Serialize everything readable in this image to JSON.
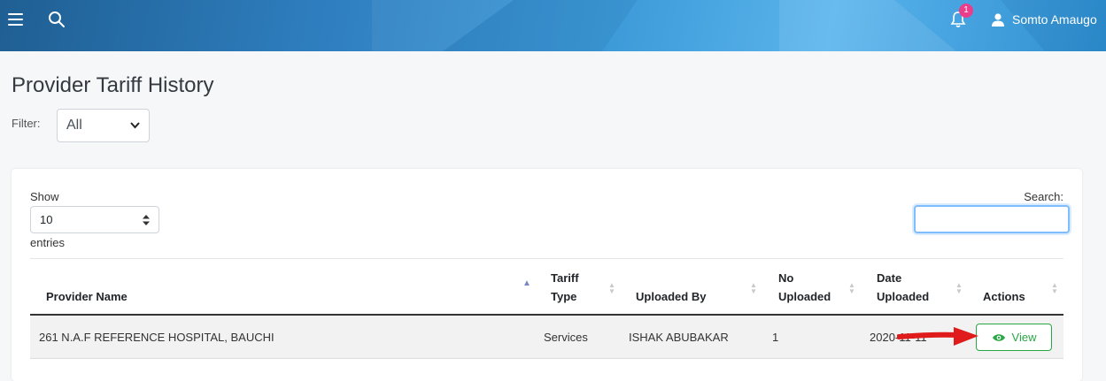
{
  "header": {
    "menu_icon": "hamburger-icon",
    "search_icon": "search-icon",
    "notification_icon": "bell-icon",
    "notification_count": "1",
    "user_icon": "user-icon",
    "user_name": "Somto Amaugo"
  },
  "page": {
    "title": "Provider Tariff History",
    "filter_label": "Filter:",
    "filter_value": "All"
  },
  "table_controls": {
    "show_label": "Show",
    "entries_value": "10",
    "entries_label": "entries",
    "search_label": "Search:",
    "search_value": ""
  },
  "table": {
    "columns": [
      "Provider Name",
      "Tariff Type",
      "Uploaded By",
      "No Uploaded",
      "Date Uploaded",
      "Actions"
    ],
    "column_lines": [
      [
        "Provider Name"
      ],
      [
        "Tariff",
        "Type"
      ],
      [
        "Uploaded By"
      ],
      [
        "No",
        "Uploaded"
      ],
      [
        "Date",
        "Uploaded"
      ],
      [
        "Actions"
      ]
    ],
    "sorted_column": "Provider Name",
    "rows": [
      {
        "provider_name": "261 N.A.F REFERENCE HOSPITAL, BAUCHI",
        "tariff_type": "Services",
        "uploaded_by": "ISHAK ABUBAKAR",
        "no_uploaded": "1",
        "date_uploaded": "2020-11-11",
        "action_label": "View",
        "action_icon": "eye-icon"
      }
    ]
  },
  "annotation": {
    "arrow_color": "#e01b1b",
    "arrow_icon": "arrow-right-icon"
  },
  "colors": {
    "accent": "#28a745",
    "header": "#3d9ad8",
    "badge": "#e83e8c"
  }
}
